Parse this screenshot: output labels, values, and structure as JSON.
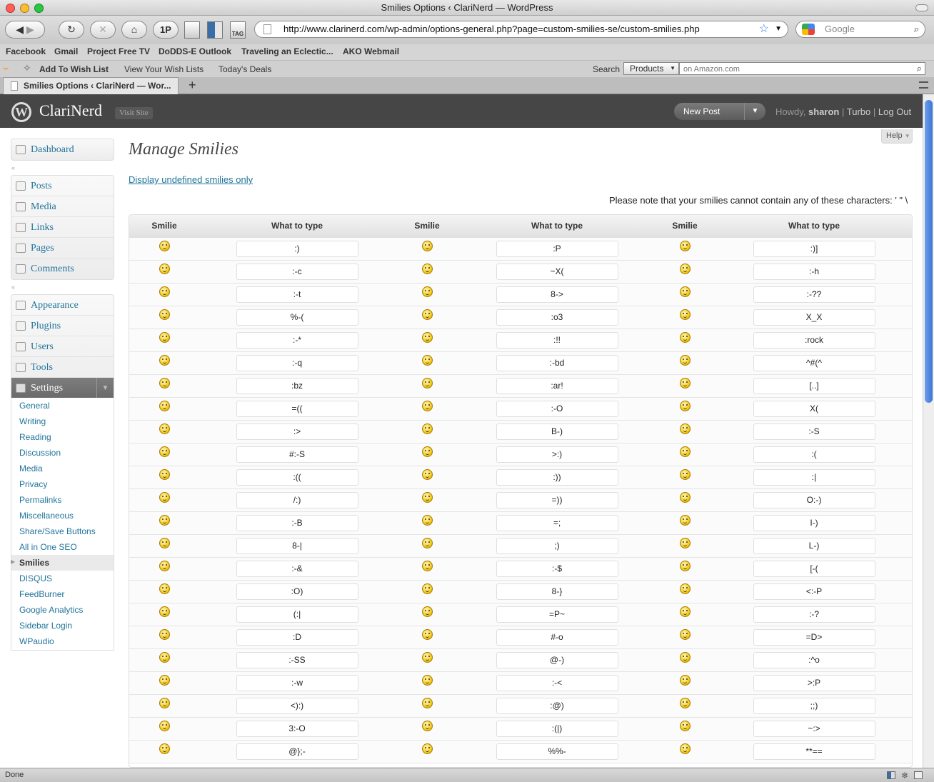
{
  "window": {
    "title": "Smilies Options ‹ ClariNerd — WordPress"
  },
  "browser": {
    "url": "http://www.clarinerd.com/wp-admin/options-general.php?page=custom-smilies-se/custom-smilies.php",
    "search_placeholder": "Google",
    "onepassword_label": "1P",
    "tag_label": "TAG",
    "bookmarks": [
      "Facebook",
      "Gmail",
      "Project Free TV",
      "DoDDS-E Outlook",
      "Traveling an Eclectic...",
      "AKO Webmail"
    ],
    "amazon": {
      "add_wish": "Add To Wish List",
      "view_wish": "View Your Wish Lists",
      "deals": "Today's Deals",
      "search_label": "Search",
      "category": "Products",
      "input_placeholder": "on Amazon.com"
    },
    "tab_title": "Smilies Options ‹ ClariNerd — Wor...",
    "new_tab": "+",
    "status": "Done"
  },
  "header": {
    "site_name": "ClariNerd",
    "visit_site": "Visit Site",
    "new_post": "New Post",
    "howdy": "Howdy,",
    "user": "sharon",
    "sep1": "|",
    "turbo": "Turbo",
    "sep2": "|",
    "logout": "Log Out"
  },
  "sidebar": {
    "dashboard": "Dashboard",
    "group1": [
      "Posts",
      "Media",
      "Links",
      "Pages",
      "Comments"
    ],
    "group2": [
      "Appearance",
      "Plugins",
      "Users",
      "Tools"
    ],
    "settings": "Settings",
    "settings_sub": [
      "General",
      "Writing",
      "Reading",
      "Discussion",
      "Media",
      "Privacy",
      "Permalinks",
      "Miscellaneous",
      "Share/Save Buttons",
      "All in One SEO",
      "Smilies",
      "DISQUS",
      "FeedBurner",
      "Google Analytics",
      "Sidebar Login",
      "WPaudio"
    ],
    "active_sub": "Smilies"
  },
  "main": {
    "title": "Manage Smilies",
    "help": "Help",
    "undefined_link": "Display undefined smilies only",
    "note": "Please note that your smilies cannot contain any of these characters: ' \" \\",
    "col_smilie": "Smilie",
    "col_type": "What to type",
    "rows": [
      [
        ":)",
        ":P",
        ":)]"
      ],
      [
        ":-c",
        "~X(",
        ":-h"
      ],
      [
        ":-t",
        "8->",
        ":-??"
      ],
      [
        "%-(",
        ":o3",
        "X_X"
      ],
      [
        ":-*",
        ":!!",
        ":rock"
      ],
      [
        ":-q",
        ":-bd",
        "^#(^"
      ],
      [
        ":bz",
        ":ar!",
        "[..]"
      ],
      [
        "=((",
        ":-O",
        "X("
      ],
      [
        ":>",
        "B-)",
        ":-S"
      ],
      [
        "#:-S",
        ">:)",
        ":("
      ],
      [
        ":((",
        ":))",
        ":|"
      ],
      [
        "/:)",
        "=))",
        "O:-)"
      ],
      [
        ":-B",
        "=;",
        "I-)"
      ],
      [
        "8-|",
        ";)",
        "L-)"
      ],
      [
        ":-&",
        ":-$",
        "[-("
      ],
      [
        ":O)",
        "8-}",
        "<:-P"
      ],
      [
        "(:|",
        "=P~",
        ":-?"
      ],
      [
        ":D",
        "#-o",
        "=D>"
      ],
      [
        ":-SS",
        "@-)",
        ":^o"
      ],
      [
        ":-w",
        ":-<",
        ">:P"
      ],
      [
        "<):)",
        ":@)",
        ";;)"
      ],
      [
        "3:-O",
        ":(|)",
        "~:>"
      ],
      [
        "@};-",
        "%%-",
        "**=="
      ]
    ]
  }
}
